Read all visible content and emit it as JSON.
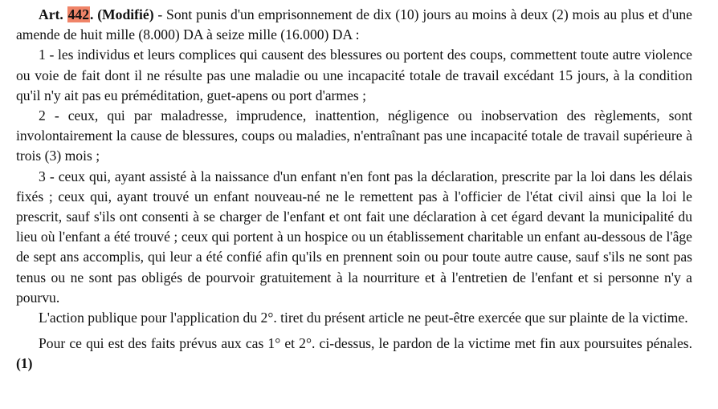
{
  "article": {
    "label": "Art.",
    "number": "442",
    "after_number": ".",
    "modified": "(Modifié)",
    "intro": " - Sont punis d'un emprisonnement de dix (10) jours au moins à deux (2) mois au plus et d'une amende de huit mille (8.000) DA à seize mille (16.000) DA :",
    "highlight_color": "#f08468"
  },
  "items": [
    "1 - les individus et leurs complices qui causent des blessures ou portent des coups, commettent toute autre violence ou voie de fait dont il ne résulte pas une maladie ou une incapacité totale de travail excédant 15 jours, à la condition qu'il n'y ait pas eu préméditation, guet-apens ou port d'armes ;",
    "2 - ceux, qui par maladresse, imprudence, inattention, négligence ou inobservation des règlements, sont involontairement la cause de blessures, coups ou maladies, n'entraînant pas une incapacité totale de travail supérieure à trois (3) mois ;",
    "3 - ceux qui, ayant assisté à la naissance d'un enfant n'en font pas la déclaration, prescrite par la loi dans les délais fixés ; ceux qui, ayant trouvé un enfant nouveau-né ne le remettent pas à l'officier de l'état civil ainsi que la loi le prescrit, sauf s'ils ont consenti à se charger de l'enfant et ont fait une déclaration à cet égard devant la municipalité du lieu où l'enfant a été trouvé ; ceux qui portent à un hospice ou un établissement charitable un enfant au-dessous de l'âge de sept ans accomplis, qui leur a été confié afin qu'ils en prennent soin ou pour toute autre cause, sauf s'ils ne sont pas tenus ou ne sont pas obligés de pourvoir gratuitement à la nourriture et à l'entretien de l'enfant et si personne n'y a pourvu."
  ],
  "action_publique": "L'action publique pour l'application du 2°. tiret du présent article ne peut-être exercée que sur plainte de la victime.",
  "pardon": {
    "text": "Pour ce qui est des faits prévus aux cas 1° et 2°. ci-dessus, le pardon de la victime met fin aux poursuites pénales. ",
    "note": "(1)"
  }
}
